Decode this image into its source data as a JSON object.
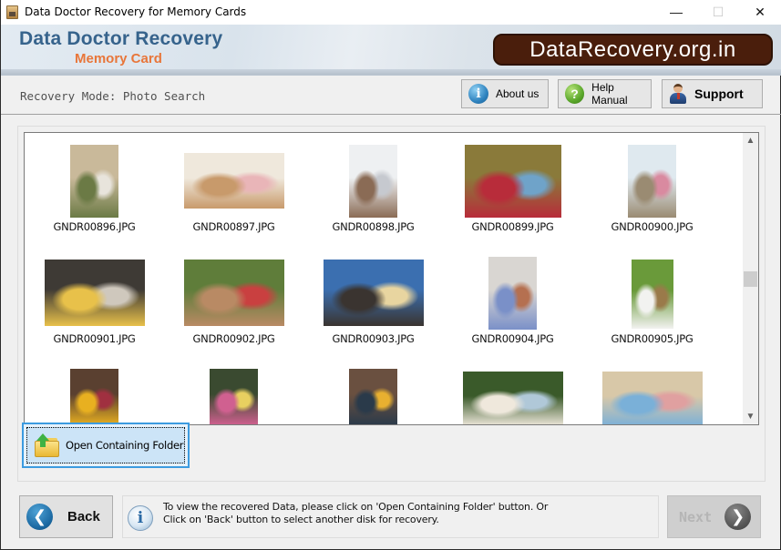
{
  "window": {
    "title": "Data Doctor Recovery for Memory Cards",
    "controls": {
      "minimize": "—",
      "maximize": "☐",
      "close": "✕"
    }
  },
  "banner": {
    "brand_title": "Data Doctor Recovery",
    "brand_subtitle": "Memory Card",
    "site_badge": "DataRecovery.org.in"
  },
  "toolbar": {
    "mode_label": "Recovery Mode: Photo Search",
    "about_label": "About us",
    "about_icon": "info-icon",
    "help_label": "Help Manual",
    "help_icon": "question-icon",
    "support_label": "Support",
    "support_icon": "support-agent-icon"
  },
  "gallery": {
    "files": [
      {
        "name": "GNDR00896.JPG",
        "palette": [
          "#c9b99a",
          "#6b7a45",
          "#e8e4dc"
        ]
      },
      {
        "name": "GNDR00897.JPG",
        "palette": [
          "#efe8dc",
          "#c89a6b",
          "#e9b5b8"
        ]
      },
      {
        "name": "GNDR00898.JPG",
        "palette": [
          "#eef0f2",
          "#8a6b55",
          "#c6c9cf"
        ]
      },
      {
        "name": "GNDR00899.JPG",
        "palette": [
          "#8a7a3a",
          "#b82c3a",
          "#6fa3c9"
        ]
      },
      {
        "name": "GNDR00900.JPG",
        "palette": [
          "#dfe9ef",
          "#9a8b72",
          "#d98aa0"
        ]
      },
      {
        "name": "GNDR00901.JPG",
        "palette": [
          "#3e3a35",
          "#e8c14a",
          "#cfc8bd"
        ]
      },
      {
        "name": "GNDR00902.JPG",
        "palette": [
          "#5f7d3a",
          "#b98a64",
          "#c94040"
        ]
      },
      {
        "name": "GNDR00903.JPG",
        "palette": [
          "#3b6fb0",
          "#3a3430",
          "#e8d5a0"
        ]
      },
      {
        "name": "GNDR00904.JPG",
        "palette": [
          "#d9d6d2",
          "#7a90c8",
          "#b57050"
        ]
      },
      {
        "name": "GNDR00905.JPG",
        "palette": [
          "#6a9a3a",
          "#f2f2f0",
          "#9a7a4a"
        ]
      },
      {
        "name": "",
        "palette": [
          "#5a4030",
          "#e8b020",
          "#a03040"
        ]
      },
      {
        "name": "",
        "palette": [
          "#3a4a30",
          "#d06090",
          "#e8d060"
        ]
      },
      {
        "name": "",
        "palette": [
          "#6a5040",
          "#2a3a4a",
          "#e8b030"
        ]
      },
      {
        "name": "",
        "palette": [
          "#3a5a2a",
          "#efe8dc",
          "#b0c8d8"
        ]
      },
      {
        "name": "",
        "palette": [
          "#d8c8a8",
          "#7ab0d8",
          "#e0a0a0"
        ]
      }
    ],
    "scroll_position": 0.5
  },
  "actions": {
    "open_folder_label": "Open Containing Folder"
  },
  "footer": {
    "back_label": "Back",
    "next_label": "Next",
    "info_line1": "To view the recovered Data, please click on 'Open Containing Folder' button. Or",
    "info_line2": "Click on 'Back' button to select another disk for recovery."
  }
}
